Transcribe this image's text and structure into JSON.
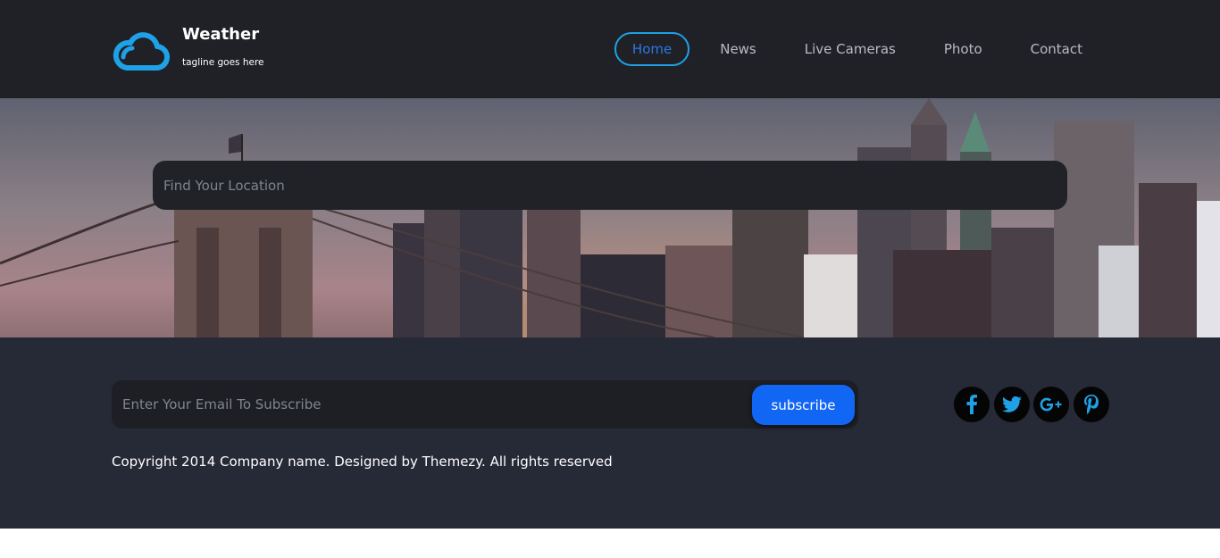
{
  "header": {
    "brand_title": "Weather",
    "tagline": "tagline goes here",
    "logo_icon": "cloud-icon",
    "accent_color": "#1ea1e6",
    "nav": [
      {
        "label": "Home",
        "active": true
      },
      {
        "label": "News",
        "active": false
      },
      {
        "label": "Live Cameras",
        "active": false
      },
      {
        "label": "Photo",
        "active": false
      },
      {
        "label": "Contact",
        "active": false
      }
    ]
  },
  "hero": {
    "search_placeholder": "Find Your Location",
    "background": "city-skyline-bridge-photo"
  },
  "footer": {
    "email_placeholder": "Enter Your Email To Subscribe",
    "subscribe_label": "subscribe",
    "subscribe_color": "#1167f3",
    "social": [
      {
        "name": "facebook-icon"
      },
      {
        "name": "twitter-icon"
      },
      {
        "name": "google-plus-icon"
      },
      {
        "name": "pinterest-icon"
      }
    ],
    "copyright": "Copyright 2014 Company name. Designed by Themezy. All rights reserved"
  }
}
